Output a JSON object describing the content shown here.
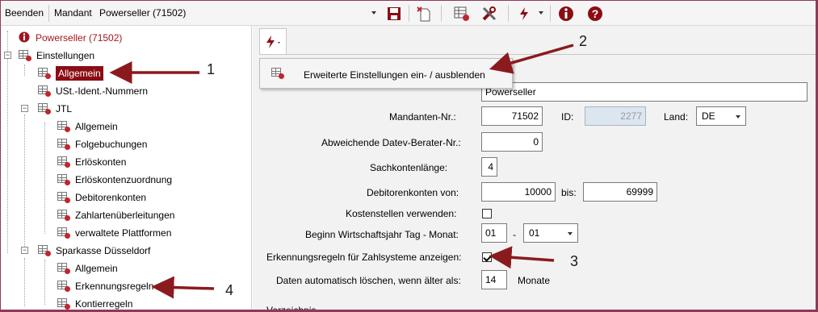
{
  "toolbar": {
    "quit_label": "Beenden",
    "client_label": "Mandant",
    "client_value": "Powerseller (71502)",
    "icons": [
      "save-icon",
      "new-document-icon",
      "table-settings-icon",
      "tools-icon",
      "flash-icon",
      "info-icon",
      "help-icon"
    ]
  },
  "tree": {
    "root": "Powerseller (71502)",
    "settings": "Einstellungen",
    "general": "Allgemein",
    "vat": "USt.-Ident.-Nummern",
    "jtl": "JTL",
    "jtl_items": [
      "Allgemein",
      "Folgebuchungen",
      "Erlöskonten",
      "Erlöskontenzuordnung",
      "Debitorenkonten",
      "Zahlartenüberleitungen",
      "verwaltete Plattformen"
    ],
    "bank": "Sparkasse Düsseldorf",
    "bank_items": [
      "Allgemein",
      "Erkennungsregeln",
      "Kontierregeln"
    ]
  },
  "menu": {
    "item_label": "Erweiterte Einstellungen ein- / ausblenden"
  },
  "form": {
    "name_value": "Powerseller",
    "client_nr_label": "Mandanten-Nr.:",
    "client_nr_value": "71502",
    "id_label": "ID:",
    "id_value": "2277",
    "country_label": "Land:",
    "country_value": "DE",
    "datev_label": "Abweichende Datev-Berater-Nr.:",
    "datev_value": "0",
    "account_length_label": "Sachkontenlänge:",
    "account_length_value": "4",
    "debtor_from_label": "Debitorenkonten von:",
    "debtor_from_value": "10000",
    "debtor_to_label": "bis:",
    "debtor_to_value": "69999",
    "cost_center_label": "Kostenstellen verwenden:",
    "cost_center_checked": false,
    "fiscal_label": "Beginn Wirtschaftsjahr Tag - Monat:",
    "fiscal_day": "01",
    "fiscal_sep": "-",
    "fiscal_month": "01",
    "rules_label": "Erkennungsregeln für Zahlsysteme anzeigen:",
    "rules_checked": true,
    "autodelete_label": "Daten automatisch löschen, wenn älter als:",
    "autodelete_value": "14",
    "autodelete_unit": "Monate",
    "partial_label": "Verzeichnis"
  },
  "callouts": [
    "1",
    "2",
    "3",
    "4"
  ],
  "colors": {
    "accent": "#8b0d14",
    "arrow": "#8b1a1f",
    "frame": "#8e3a59"
  }
}
